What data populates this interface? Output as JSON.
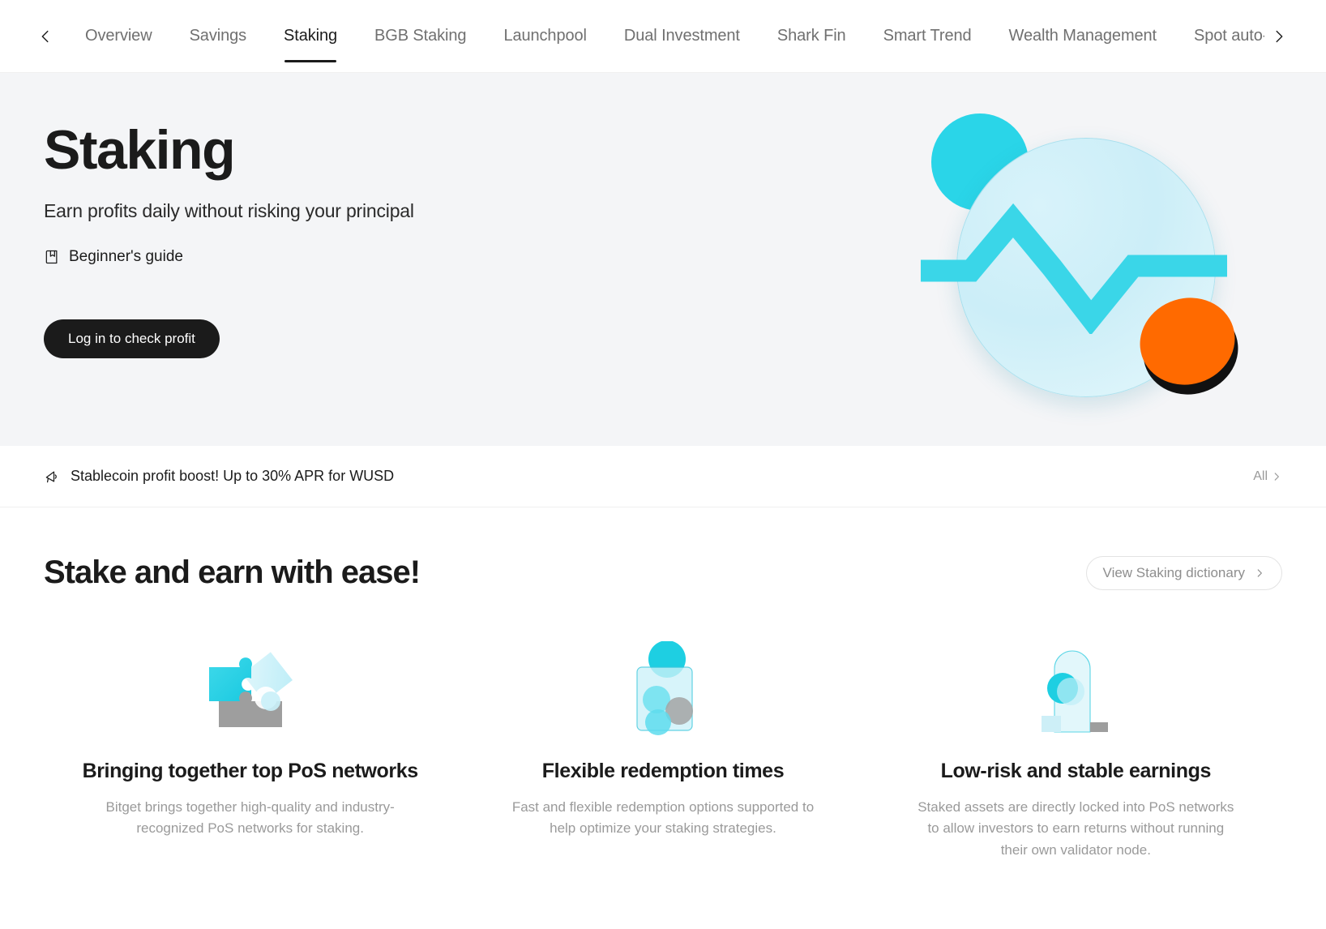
{
  "nav": {
    "prev_icon": "chevron-left-icon",
    "next_icon": "chevron-right-icon",
    "tabs": [
      {
        "label": "Overview",
        "active": false
      },
      {
        "label": "Savings",
        "active": false
      },
      {
        "label": "Staking",
        "active": true
      },
      {
        "label": "BGB Staking",
        "active": false
      },
      {
        "label": "Launchpool",
        "active": false
      },
      {
        "label": "Dual Investment",
        "active": false
      },
      {
        "label": "Shark Fin",
        "active": false
      },
      {
        "label": "Smart Trend",
        "active": false
      },
      {
        "label": "Wealth Management",
        "active": false
      },
      {
        "label": "Spot auto-invest",
        "active": false
      }
    ]
  },
  "hero": {
    "title": "Staking",
    "subtitle": "Earn profits daily without risking your principal",
    "guide_label": "Beginner's guide",
    "guide_icon": "book-icon",
    "cta_label": "Log in to check profit",
    "background": "#f4f5f7",
    "accent_cyan": "#2ad5e8",
    "accent_orange": "#ff6a00",
    "illustration": "growth-chart-illustration"
  },
  "announcement": {
    "icon": "megaphone-icon",
    "text": "Stablecoin profit boost! Up to 30% APR for WUSD",
    "all_label": "All",
    "all_icon": "chevron-right-icon"
  },
  "section": {
    "title": "Stake and earn with ease!",
    "dictionary_button": "View Staking dictionary",
    "dictionary_icon": "chevron-right-icon",
    "features": [
      {
        "icon": "puzzle-piece-icon",
        "title": "Bringing together top PoS networks",
        "desc": "Bitget brings together high-quality and industry-recognized PoS networks for staking."
      },
      {
        "icon": "coin-jar-icon",
        "title": "Flexible redemption times",
        "desc": "Fast and flexible redemption options supported to help optimize your staking strategies."
      },
      {
        "icon": "stability-pillar-icon",
        "title": "Low-risk and stable earnings",
        "desc": "Staked assets are directly locked into PoS networks to allow investors to earn returns without running their own validator node."
      }
    ]
  }
}
